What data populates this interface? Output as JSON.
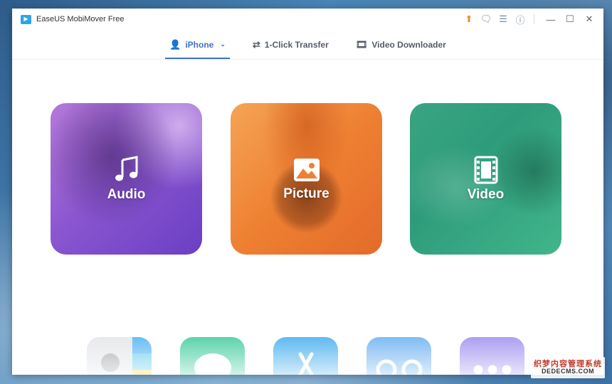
{
  "window": {
    "title": "EaseUS MobiMover Free",
    "logo_glyph": "▶"
  },
  "titlebar": {
    "icons": [
      {
        "name": "upgrade-arrow-icon",
        "glyph": "⬆"
      },
      {
        "name": "feedback-icon",
        "glyph": "🗨"
      },
      {
        "name": "menu-icon",
        "glyph": "☰"
      },
      {
        "name": "info-icon",
        "glyph": "ⓘ"
      }
    ],
    "controls": [
      {
        "name": "minimize-button",
        "glyph": "—"
      },
      {
        "name": "maximize-button",
        "glyph": "☐"
      },
      {
        "name": "close-button",
        "glyph": "✕"
      }
    ]
  },
  "nav": {
    "tabs": [
      {
        "name": "tab-iphone",
        "label": "iPhone",
        "icon": "person-icon",
        "icon_glyph": "👤",
        "active": true,
        "dropdown_glyph": "⌄"
      },
      {
        "name": "tab-1-click-transfer",
        "label": "1-Click Transfer",
        "icon": "transfer-arrows-icon",
        "icon_glyph": "⇄",
        "active": false
      },
      {
        "name": "tab-video-downloader",
        "label": "Video Downloader",
        "icon": "video-download-icon",
        "icon_glyph": "🎞",
        "active": false
      }
    ]
  },
  "categories": [
    {
      "name": "audio",
      "label": "Audio",
      "icon": "music-note-icon"
    },
    {
      "name": "picture",
      "label": "Picture",
      "icon": "image-icon"
    },
    {
      "name": "video",
      "label": "Video",
      "icon": "film-icon"
    }
  ],
  "apps": [
    {
      "name": "contacts",
      "icon": "contacts-icon"
    },
    {
      "name": "messages",
      "icon": "messages-icon"
    },
    {
      "name": "apps",
      "icon": "app-store-icon"
    },
    {
      "name": "voicemail",
      "icon": "voicemail-icon"
    },
    {
      "name": "more",
      "icon": "more-icon"
    }
  ],
  "colors": {
    "accent": "#3f72c8",
    "audio": "#8a56d0",
    "picture": "#ee8032",
    "video": "#2e9c7a",
    "messages": "#4dcfa3",
    "apps": "#4fb3ef",
    "voicemail": "#74b6f2",
    "more": "#a596ef"
  },
  "watermark": {
    "line1": "织梦内容管理系统",
    "line2": "DEDECMS.COM"
  }
}
